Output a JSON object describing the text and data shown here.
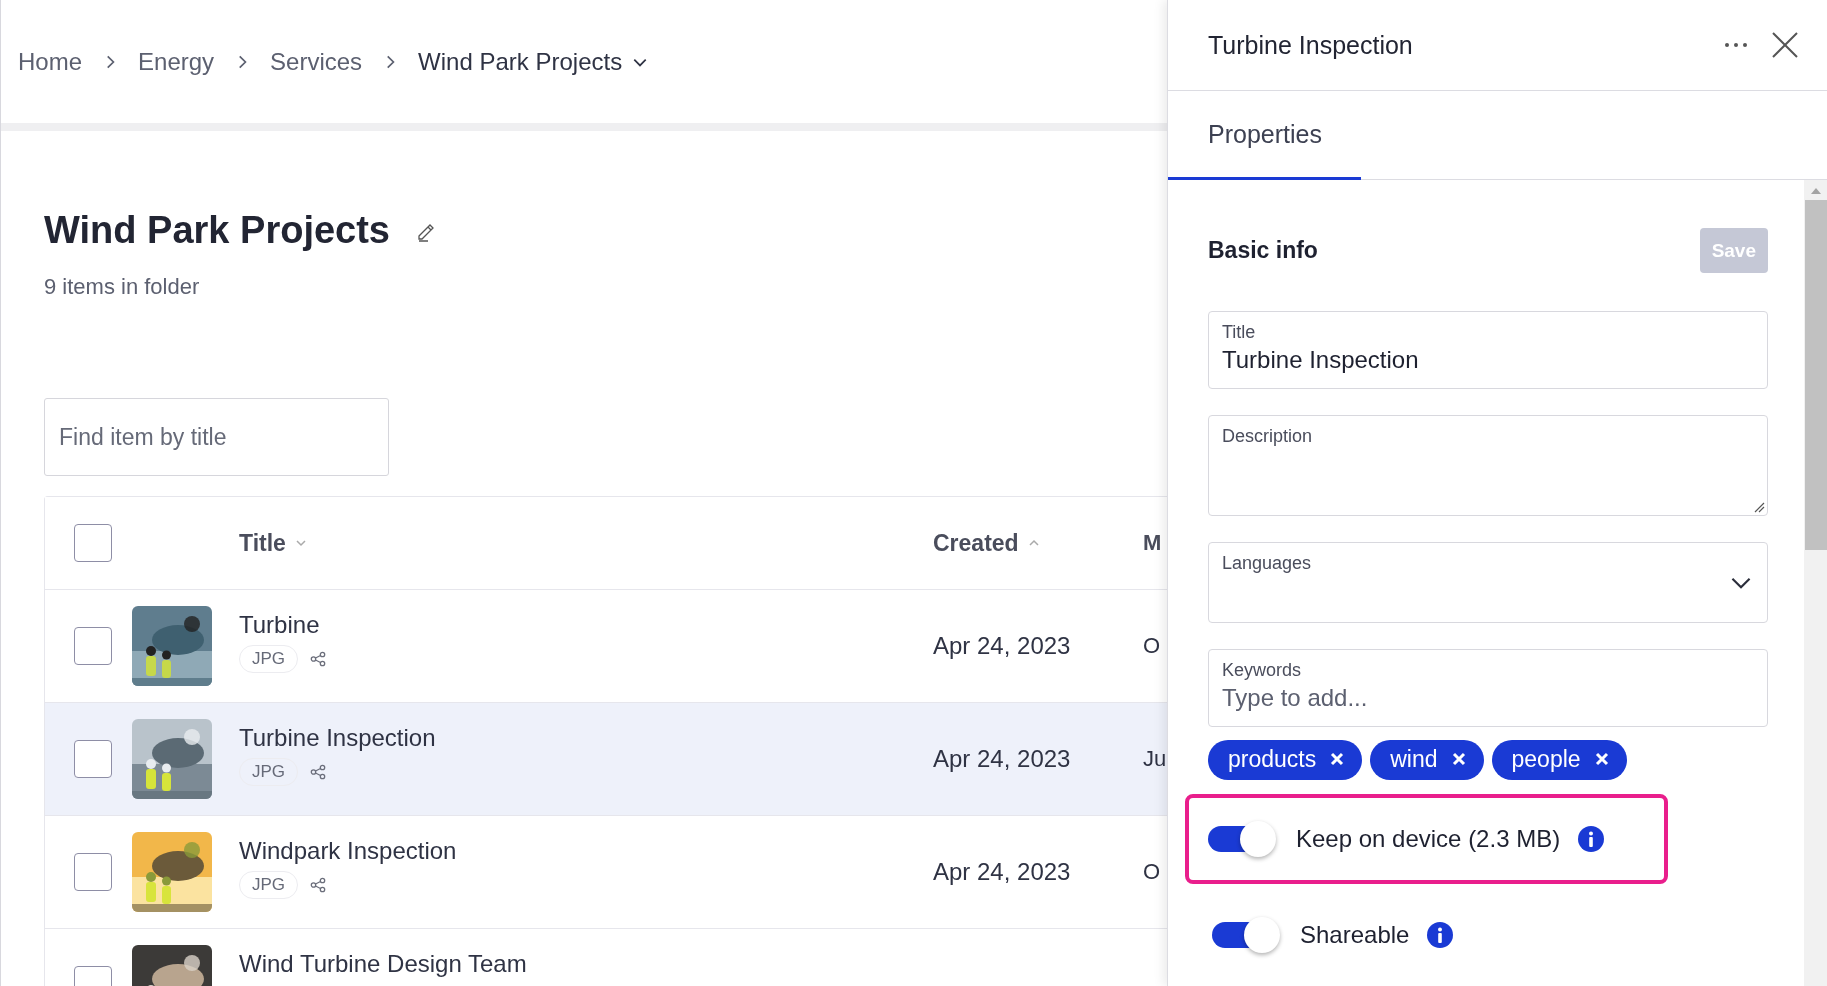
{
  "breadcrumb": {
    "links": [
      "Home",
      "Energy",
      "Services"
    ],
    "current": "Wind Park Projects"
  },
  "folder": {
    "title": "Wind Park Projects",
    "item_count": "9 items in folder"
  },
  "search": {
    "placeholder": "Find item by title"
  },
  "table": {
    "header_checked": false,
    "columns": [
      {
        "label": "Title",
        "sort_ascending": false
      },
      {
        "label": "Created",
        "sort_ascending": true
      },
      {
        "label": "M"
      }
    ],
    "rows": [
      {
        "title": "Turbine",
        "type": "JPG",
        "created": "Apr 24, 2023",
        "column_3": "O",
        "selected": false,
        "checked": false
      },
      {
        "title": "Turbine Inspection",
        "type": "JPG",
        "created": "Apr 24, 2023",
        "column_3": "Ju",
        "selected": true,
        "checked": false
      },
      {
        "title": "Windpark Inspection",
        "type": "JPG",
        "created": "Apr 24, 2023",
        "column_3": "O",
        "selected": false,
        "checked": false
      },
      {
        "title": "Wind Turbine Design Team",
        "selected": false,
        "checked": false
      }
    ]
  },
  "panel": {
    "title": "Turbine Inspection",
    "tabs": [
      {
        "label": "Properties",
        "selected": true
      }
    ],
    "section": "Basic info",
    "save": {
      "label": "Save",
      "disabled": true
    },
    "fields": [
      {
        "kind": "text",
        "label": "Title",
        "value": "Turbine Inspection"
      },
      {
        "kind": "textarea",
        "label": "Description"
      },
      {
        "kind": "select",
        "label": "Languages"
      },
      {
        "kind": "text",
        "label": "Keywords",
        "placeholder": "Type to add..."
      }
    ],
    "keywords": [
      "products",
      "wind",
      "people"
    ],
    "toggles": [
      {
        "label": "Keep on device (2.3 MB)",
        "on": true,
        "highlighted": true
      },
      {
        "label": "Shareable",
        "on": true,
        "highlighted": false
      }
    ]
  }
}
